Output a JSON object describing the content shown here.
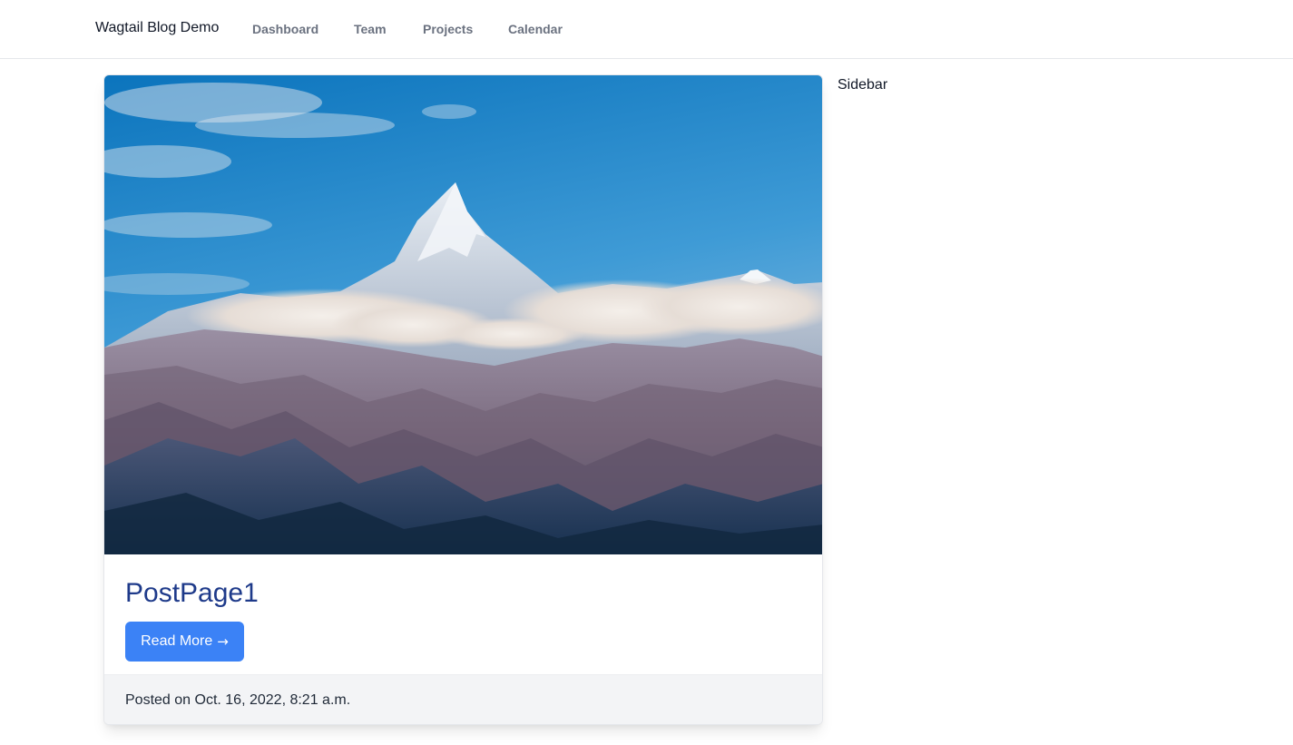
{
  "navbar": {
    "brand": "Wagtail Blog Demo",
    "links": [
      {
        "label": "Dashboard"
      },
      {
        "label": "Team"
      },
      {
        "label": "Projects"
      },
      {
        "label": "Calendar"
      }
    ]
  },
  "post": {
    "image_icon": "mountain-landscape-image",
    "title": "PostPage1",
    "read_more_label": "Read More",
    "read_more_icon": "→",
    "posted": "Posted on Oct. 16, 2022, 8:21 a.m."
  },
  "sidebar": {
    "title": "Sidebar"
  },
  "colors": {
    "primary_button": "#3b82f6",
    "title": "#1e3a8a",
    "nav_link": "#6b7280",
    "footer_bg": "#f3f4f6"
  }
}
